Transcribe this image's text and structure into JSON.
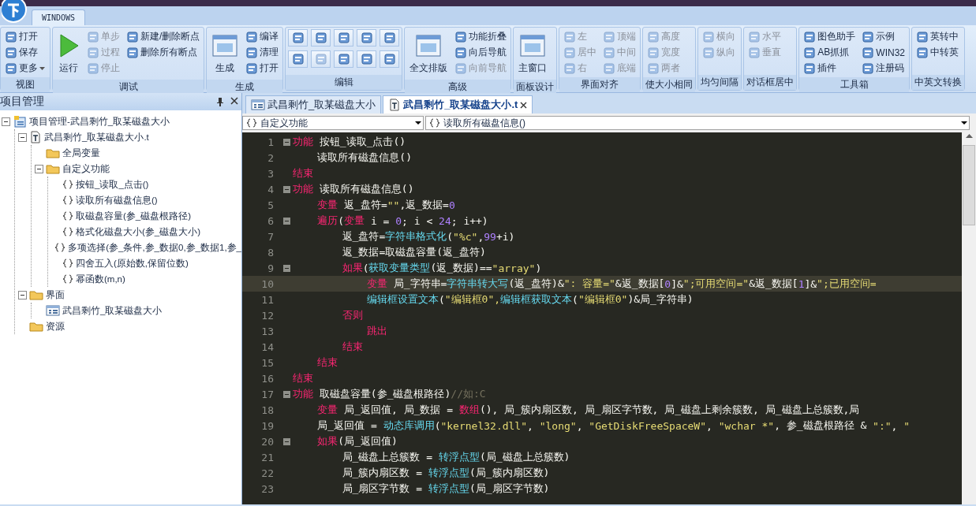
{
  "ribbon": {
    "tabs": [
      {
        "label": "WINDOWS",
        "selected": true
      }
    ],
    "groups": [
      {
        "label": "视图",
        "columns": [
          {
            "items": [
              {
                "kind": "small",
                "label": "打开",
                "disabled": false
              },
              {
                "kind": "small",
                "label": "保存",
                "disabled": false
              },
              {
                "kind": "small",
                "label": "更多",
                "disabled": false,
                "dropdown": true
              }
            ]
          }
        ]
      },
      {
        "label": "调试",
        "columns": [
          {
            "items": [
              {
                "kind": "run",
                "label": "运行",
                "disabled": false
              }
            ]
          },
          {
            "items": [
              {
                "kind": "small",
                "label": "单步",
                "disabled": true
              },
              {
                "kind": "small",
                "label": "过程",
                "disabled": true
              },
              {
                "kind": "small",
                "label": "停止",
                "disabled": true
              }
            ]
          },
          {
            "items": [
              {
                "kind": "small",
                "label": "新建/删除断点",
                "disabled": false
              },
              {
                "kind": "small",
                "label": "删除所有断点",
                "disabled": false
              }
            ]
          }
        ]
      },
      {
        "label": "生成",
        "columns": [
          {
            "items": [
              {
                "kind": "large",
                "label": "生成",
                "disabled": false
              }
            ]
          },
          {
            "items": [
              {
                "kind": "small",
                "label": "编译",
                "disabled": false
              },
              {
                "kind": "small",
                "label": "清理",
                "disabled": false
              },
              {
                "kind": "small",
                "label": "打开",
                "disabled": false
              }
            ]
          }
        ]
      },
      {
        "label": "编辑",
        "columns": [
          {
            "items": [
              {
                "kind": "icon",
                "disabled": false
              },
              {
                "kind": "icon",
                "disabled": false
              }
            ]
          },
          {
            "items": [
              {
                "kind": "icon",
                "disabled": false
              },
              {
                "kind": "icon",
                "disabled": true
              }
            ]
          },
          {
            "items": [
              {
                "kind": "icon",
                "disabled": false
              },
              {
                "kind": "icon",
                "disabled": false
              }
            ]
          },
          {
            "items": [
              {
                "kind": "icon",
                "disabled": false
              },
              {
                "kind": "icon",
                "disabled": false
              }
            ]
          },
          {
            "items": [
              {
                "kind": "icon",
                "disabled": false
              },
              {
                "kind": "icon",
                "disabled": false
              }
            ]
          }
        ]
      },
      {
        "label": "高级",
        "columns": [
          {
            "items": [
              {
                "kind": "large",
                "label": "全文排版",
                "disabled": false
              }
            ]
          },
          {
            "items": [
              {
                "kind": "small",
                "label": "功能折叠",
                "disabled": false
              },
              {
                "kind": "small",
                "label": "向后导航",
                "disabled": false
              },
              {
                "kind": "small",
                "label": "向前导航",
                "disabled": true
              }
            ]
          }
        ]
      },
      {
        "label": "面板设计",
        "columns": [
          {
            "items": [
              {
                "kind": "large",
                "label": "主窗口",
                "disabled": false
              }
            ]
          }
        ]
      },
      {
        "label": "界面对齐",
        "columns": [
          {
            "items": [
              {
                "kind": "small",
                "label": "左",
                "disabled": true
              },
              {
                "kind": "small",
                "label": "居中",
                "disabled": true
              },
              {
                "kind": "small",
                "label": "右",
                "disabled": true
              }
            ]
          },
          {
            "items": [
              {
                "kind": "small",
                "label": "顶端",
                "disabled": true
              },
              {
                "kind": "small",
                "label": "中间",
                "disabled": true
              },
              {
                "kind": "small",
                "label": "底端",
                "disabled": true
              }
            ]
          }
        ]
      },
      {
        "label": "使大小相同",
        "columns": [
          {
            "items": [
              {
                "kind": "small",
                "label": "高度",
                "disabled": true
              },
              {
                "kind": "small",
                "label": "宽度",
                "disabled": true
              },
              {
                "kind": "small",
                "label": "两者",
                "disabled": true
              }
            ]
          }
        ]
      },
      {
        "label": "均匀间隔",
        "columns": [
          {
            "items": [
              {
                "kind": "small",
                "label": "横向",
                "disabled": true
              },
              {
                "kind": "small",
                "label": "纵向",
                "disabled": true
              }
            ]
          }
        ]
      },
      {
        "label": "对话框居中",
        "columns": [
          {
            "items": [
              {
                "kind": "small",
                "label": "水平",
                "disabled": true
              },
              {
                "kind": "small",
                "label": "垂直",
                "disabled": true
              }
            ]
          }
        ]
      },
      {
        "label": "工具箱",
        "columns": [
          {
            "items": [
              {
                "kind": "small",
                "label": "图色助手",
                "disabled": false
              },
              {
                "kind": "small",
                "label": "AB抓抓",
                "disabled": false
              },
              {
                "kind": "small",
                "label": "插件",
                "disabled": false
              }
            ]
          },
          {
            "items": [
              {
                "kind": "small",
                "label": "示例",
                "disabled": false
              },
              {
                "kind": "small",
                "label": "WIN32",
                "disabled": false
              },
              {
                "kind": "small",
                "label": "注册码",
                "disabled": false
              }
            ]
          }
        ]
      },
      {
        "label": "中英文转换",
        "columns": [
          {
            "items": [
              {
                "kind": "small",
                "label": "英转中",
                "disabled": false
              },
              {
                "kind": "small",
                "label": "中转英",
                "disabled": false
              }
            ]
          }
        ]
      }
    ]
  },
  "project_panel": {
    "title": "项目管理",
    "tree": [
      {
        "label": "项目管理-武昌剩竹_取某磁盘大小",
        "kind": "project",
        "expanded": true,
        "children": [
          {
            "label": "武昌剩竹_取某磁盘大小.t",
            "kind": "file",
            "expanded": true,
            "children": [
              {
                "label": "全局变量",
                "kind": "folder"
              },
              {
                "label": "自定义功能",
                "kind": "folder",
                "expanded": true,
                "children": [
                  {
                    "label": "按钮_读取_点击()",
                    "kind": "function"
                  },
                  {
                    "label": "读取所有磁盘信息()",
                    "kind": "function"
                  },
                  {
                    "label": "取磁盘容量(参_磁盘根路径)",
                    "kind": "function"
                  },
                  {
                    "label": "格式化磁盘大小(参_磁盘大小)",
                    "kind": "function"
                  },
                  {
                    "label": "多项选择(参_条件,参_数据0,参_数据1,参_",
                    "kind": "function"
                  },
                  {
                    "label": "四舍五入(原始数,保留位数)",
                    "kind": "function"
                  },
                  {
                    "label": "幂函数(m,n)",
                    "kind": "function"
                  }
                ]
              }
            ]
          },
          {
            "label": "界面",
            "kind": "folder",
            "expanded": true,
            "children": [
              {
                "label": "武昌剩竹_取某磁盘大小",
                "kind": "form"
              }
            ]
          },
          {
            "label": "资源",
            "kind": "folder"
          }
        ]
      }
    ]
  },
  "editor": {
    "tabs": [
      {
        "label": "武昌剩竹_取某磁盘大小",
        "kind": "form",
        "selected": false
      },
      {
        "label": "武昌剩竹_取某磁盘大小.t",
        "kind": "file",
        "selected": true
      }
    ],
    "scope_dropdown": "自定义功能",
    "function_dropdown": "读取所有磁盘信息()",
    "lines": [
      {
        "number": "1",
        "fold": true,
        "current": false,
        "tokens": [
          {
            "text": "功能",
            "kind": "keyword"
          },
          {
            "text": " 按钮_读取_点击()",
            "kind": "plain"
          }
        ]
      },
      {
        "number": "2",
        "fold": false,
        "current": false,
        "tokens": [
          {
            "text": "    读取所有磁盘信息()",
            "kind": "plain"
          }
        ]
      },
      {
        "number": "3",
        "fold": false,
        "current": false,
        "tokens": [
          {
            "text": "结束",
            "kind": "keyword"
          }
        ]
      },
      {
        "number": "4",
        "fold": true,
        "current": false,
        "tokens": [
          {
            "text": "功能",
            "kind": "keyword"
          },
          {
            "text": " 读取所有磁盘信息()",
            "kind": "plain"
          }
        ]
      },
      {
        "number": "5",
        "fold": false,
        "current": false,
        "tokens": [
          {
            "text": "    变量",
            "kind": "keyword"
          },
          {
            "text": " 返_盘符=",
            "kind": "plain"
          },
          {
            "text": "\"\"",
            "kind": "string"
          },
          {
            "text": ",返_数据=",
            "kind": "plain"
          },
          {
            "text": "0",
            "kind": "number"
          }
        ]
      },
      {
        "number": "6",
        "fold": true,
        "current": false,
        "tokens": [
          {
            "text": "    遍历",
            "kind": "keyword"
          },
          {
            "text": "(",
            "kind": "plain"
          },
          {
            "text": "变量",
            "kind": "keyword"
          },
          {
            "text": " i = ",
            "kind": "plain"
          },
          {
            "text": "0",
            "kind": "number"
          },
          {
            "text": "; i < ",
            "kind": "plain"
          },
          {
            "text": "24",
            "kind": "number"
          },
          {
            "text": "; i++)",
            "kind": "plain"
          }
        ]
      },
      {
        "number": "7",
        "fold": false,
        "current": false,
        "tokens": [
          {
            "text": "        返_盘符=",
            "kind": "plain"
          },
          {
            "text": "字符串格式化",
            "kind": "function"
          },
          {
            "text": "(",
            "kind": "plain"
          },
          {
            "text": "\"%c\"",
            "kind": "string"
          },
          {
            "text": ",",
            "kind": "plain"
          },
          {
            "text": "99",
            "kind": "number"
          },
          {
            "text": "+i)",
            "kind": "plain"
          }
        ]
      },
      {
        "number": "8",
        "fold": false,
        "current": false,
        "tokens": [
          {
            "text": "        返_数据=取磁盘容量(返_盘符)",
            "kind": "plain"
          }
        ]
      },
      {
        "number": "9",
        "fold": true,
        "current": false,
        "tokens": [
          {
            "text": "        如果",
            "kind": "keyword"
          },
          {
            "text": "(",
            "kind": "plain"
          },
          {
            "text": "获取变量类型",
            "kind": "function"
          },
          {
            "text": "(返_数据)==",
            "kind": "plain"
          },
          {
            "text": "\"array\"",
            "kind": "string"
          },
          {
            "text": ")",
            "kind": "plain"
          }
        ]
      },
      {
        "number": "10",
        "fold": false,
        "current": true,
        "tokens": [
          {
            "text": "            变量",
            "kind": "keyword"
          },
          {
            "text": " 局_字符串=",
            "kind": "plain"
          },
          {
            "text": "字符串转大写",
            "kind": "function"
          },
          {
            "text": "(返_盘符)&",
            "kind": "plain"
          },
          {
            "text": "\": 容量=\"",
            "kind": "string"
          },
          {
            "text": "&返_数据[",
            "kind": "plain"
          },
          {
            "text": "0",
            "kind": "number"
          },
          {
            "text": "]&",
            "kind": "plain"
          },
          {
            "text": "\";可用空间=\"",
            "kind": "string"
          },
          {
            "text": "&返_数据[",
            "kind": "plain"
          },
          {
            "text": "1",
            "kind": "number"
          },
          {
            "text": "]&",
            "kind": "plain"
          },
          {
            "text": "\";已用空间=",
            "kind": "string"
          }
        ]
      },
      {
        "number": "11",
        "fold": false,
        "current": false,
        "tokens": [
          {
            "text": "            编辑框设置文本",
            "kind": "function"
          },
          {
            "text": "(",
            "kind": "plain"
          },
          {
            "text": "\"编辑框0\",",
            "kind": "string"
          },
          {
            "text": "编辑框获取文本",
            "kind": "function"
          },
          {
            "text": "(",
            "kind": "plain"
          },
          {
            "text": "\"编辑框0\"",
            "kind": "string"
          },
          {
            "text": ")&局_字符串)",
            "kind": "plain"
          }
        ]
      },
      {
        "number": "12",
        "fold": false,
        "current": false,
        "tokens": [
          {
            "text": "        否则",
            "kind": "keyword"
          }
        ]
      },
      {
        "number": "13",
        "fold": false,
        "current": false,
        "tokens": [
          {
            "text": "            跳出",
            "kind": "keyword"
          }
        ]
      },
      {
        "number": "14",
        "fold": false,
        "current": false,
        "tokens": [
          {
            "text": "        结束",
            "kind": "keyword"
          }
        ]
      },
      {
        "number": "15",
        "fold": false,
        "current": false,
        "tokens": [
          {
            "text": "    结束",
            "kind": "keyword"
          }
        ]
      },
      {
        "number": "16",
        "fold": false,
        "current": false,
        "tokens": [
          {
            "text": "结束",
            "kind": "keyword"
          }
        ]
      },
      {
        "number": "17",
        "fold": true,
        "current": false,
        "tokens": [
          {
            "text": "功能",
            "kind": "keyword"
          },
          {
            "text": " 取磁盘容量(参_磁盘根路径)",
            "kind": "plain"
          },
          {
            "text": "//如:C",
            "kind": "comment"
          }
        ]
      },
      {
        "number": "18",
        "fold": false,
        "current": false,
        "tokens": [
          {
            "text": "    变量",
            "kind": "keyword"
          },
          {
            "text": " 局_返回值, 局_数据 = ",
            "kind": "plain"
          },
          {
            "text": "数组",
            "kind": "keyword"
          },
          {
            "text": "(), 局_簇内扇区数, 局_扇区字节数, 局_磁盘上剩余簇数, 局_磁盘上总簇数,局",
            "kind": "plain"
          }
        ]
      },
      {
        "number": "19",
        "fold": false,
        "current": false,
        "tokens": [
          {
            "text": "    局_返回值 = ",
            "kind": "plain"
          },
          {
            "text": "动态库调用",
            "kind": "function"
          },
          {
            "text": "(",
            "kind": "plain"
          },
          {
            "text": "\"kernel32.dll\"",
            "kind": "string"
          },
          {
            "text": ", ",
            "kind": "plain"
          },
          {
            "text": "\"long\"",
            "kind": "string"
          },
          {
            "text": ", ",
            "kind": "plain"
          },
          {
            "text": "\"GetDiskFreeSpaceW\"",
            "kind": "string"
          },
          {
            "text": ", ",
            "kind": "plain"
          },
          {
            "text": "\"wchar *\"",
            "kind": "string"
          },
          {
            "text": ", 参_磁盘根路径 & ",
            "kind": "plain"
          },
          {
            "text": "\":\"",
            "kind": "string"
          },
          {
            "text": ", ",
            "kind": "plain"
          },
          {
            "text": "\"",
            "kind": "string"
          }
        ]
      },
      {
        "number": "20",
        "fold": true,
        "current": false,
        "tokens": [
          {
            "text": "    如果",
            "kind": "keyword"
          },
          {
            "text": "(局_返回值)",
            "kind": "plain"
          }
        ]
      },
      {
        "number": "21",
        "fold": false,
        "current": false,
        "tokens": [
          {
            "text": "        局_磁盘上总簇数 = ",
            "kind": "plain"
          },
          {
            "text": "转浮点型",
            "kind": "function"
          },
          {
            "text": "(局_磁盘上总簇数)",
            "kind": "plain"
          }
        ]
      },
      {
        "number": "22",
        "fold": false,
        "current": false,
        "tokens": [
          {
            "text": "        局_簇内扇区数 = ",
            "kind": "plain"
          },
          {
            "text": "转浮点型",
            "kind": "function"
          },
          {
            "text": "(局_簇内扇区数)",
            "kind": "plain"
          }
        ]
      },
      {
        "number": "23",
        "fold": false,
        "current": false,
        "tokens": [
          {
            "text": "        局_扇区字节数 = ",
            "kind": "plain"
          },
          {
            "text": "转浮点型",
            "kind": "function"
          },
          {
            "text": "(局_扇区字节数)",
            "kind": "plain"
          }
        ]
      }
    ]
  }
}
